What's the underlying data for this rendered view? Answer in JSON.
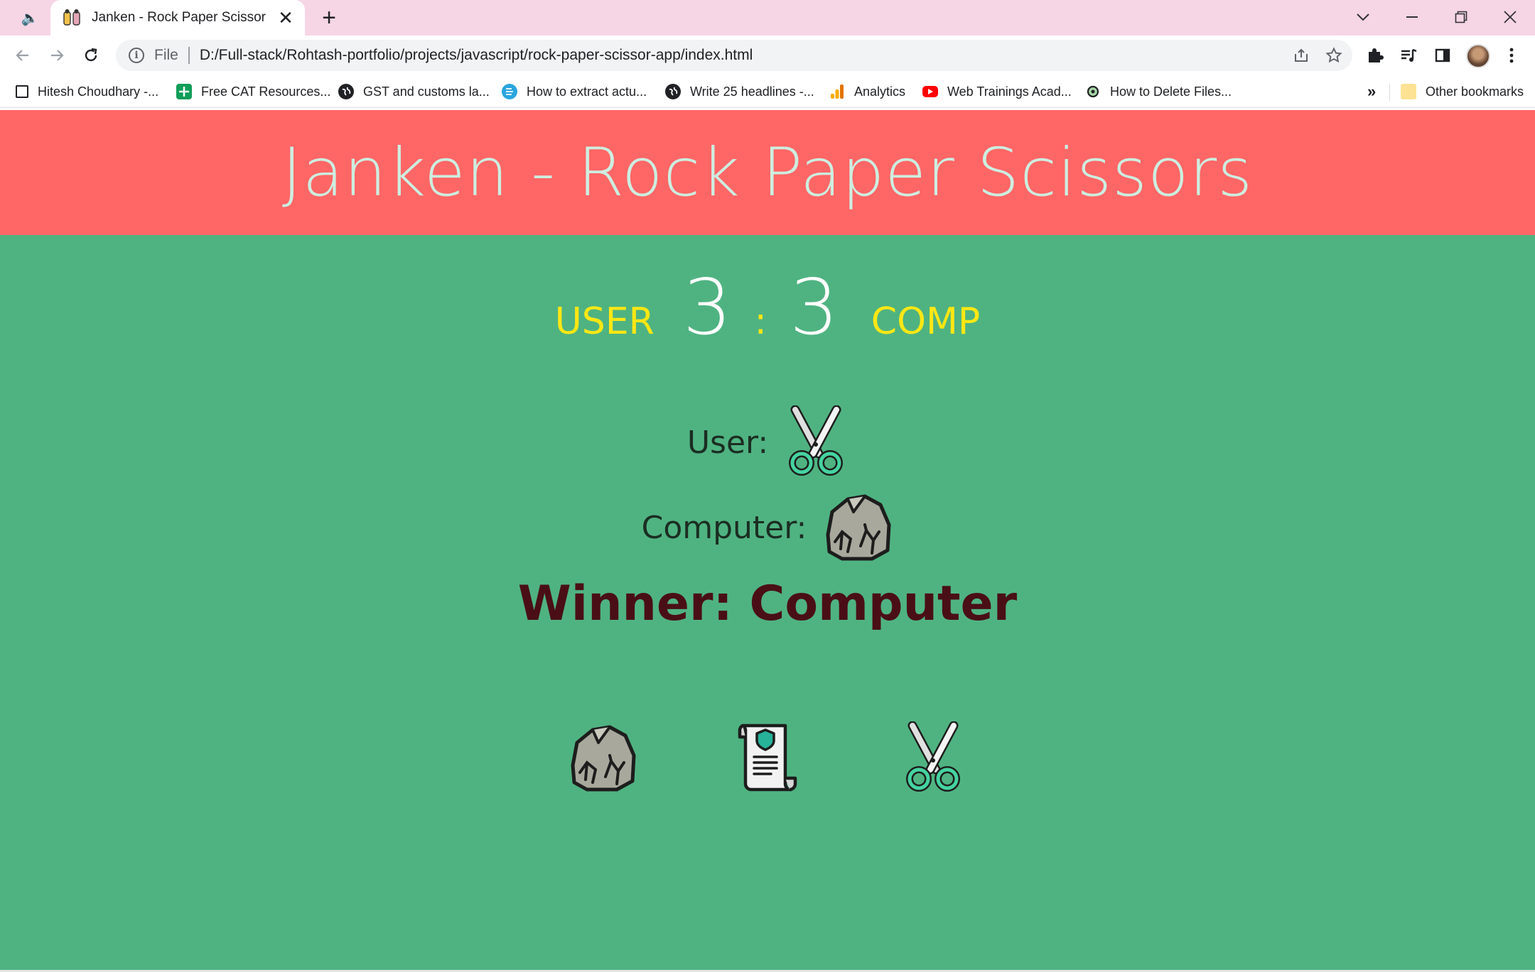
{
  "browser": {
    "tab_title": "Janken - Rock Paper Scissor",
    "scheme": "File",
    "url": "D:/Full-stack/Rohtash-portfolio/projects/javascript/rock-paper-scissor-app/index.html",
    "bookmarks": [
      {
        "label": "Hitesh Choudhary -...",
        "icon": "page-icon"
      },
      {
        "label": "Free CAT Resources...",
        "icon": "sheets-icon"
      },
      {
        "label": "GST and customs la...",
        "icon": "globe-icon"
      },
      {
        "label": "How to extract actu...",
        "icon": "edge-icon"
      },
      {
        "label": "Write 25 headlines -...",
        "icon": "globe-icon"
      },
      {
        "label": "Analytics",
        "icon": "analytics-icon"
      },
      {
        "label": "Web Trainings Acad...",
        "icon": "youtube-icon"
      },
      {
        "label": "How to Delete Files...",
        "icon": "bookmark-app-icon"
      }
    ],
    "bookmarks_overflow": "»",
    "other_bookmarks": "Other bookmarks"
  },
  "page": {
    "title": "Janken - Rock Paper Scissors",
    "score": {
      "user_label": "USER",
      "user_score": "3",
      "separator": ":",
      "comp_score": "3",
      "comp_label": "COMP"
    },
    "user_choice_label": "User:",
    "user_choice": "scissors",
    "computer_choice_label": "Computer:",
    "computer_choice": "rock",
    "winner_text": "Winner: Computer",
    "options": [
      "rock",
      "paper",
      "scissors"
    ]
  },
  "colors": {
    "header_bg": "#ff6666",
    "title_text": "#cdeee0",
    "main_bg": "#4fb381",
    "score_label": "#ffe714",
    "score_number": "#ffffff",
    "winner_text": "#4a0f16",
    "tabbar_bg": "#f6d5e5"
  }
}
